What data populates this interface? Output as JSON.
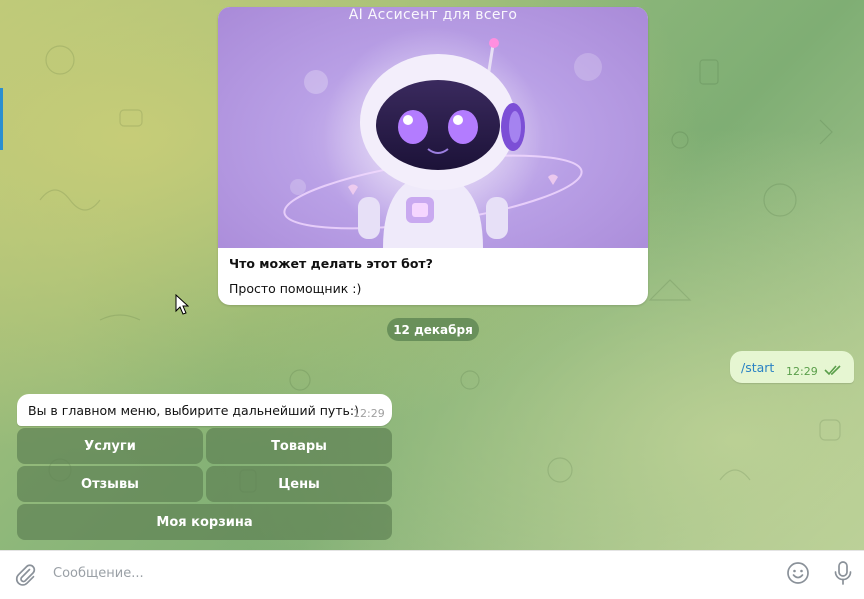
{
  "bot_card": {
    "image_title": "AI Ассисент для всего",
    "question": "Что может делать этот бот?",
    "answer": "Просто помощник :)"
  },
  "date_separator": "12 декабря",
  "outgoing": {
    "text": "/start",
    "time": "12:29",
    "status_icon": "double-check-icon"
  },
  "incoming": {
    "text": "Вы в главном меню, выбирите дальнейший путь:)",
    "time": "12:29"
  },
  "keyboard": {
    "services": "Услуги",
    "products": "Товары",
    "reviews": "Отзывы",
    "prices": "Цены",
    "cart": "Моя корзина"
  },
  "input": {
    "placeholder": "Сообщение...",
    "attach_icon": "paperclip-icon",
    "emoji_icon": "emoji-icon",
    "mic_icon": "microphone-icon"
  },
  "colors": {
    "accent": "#2a82c4",
    "outgoing_bubble": "#e6f6d2",
    "keyboard_button": "#5f8255"
  }
}
